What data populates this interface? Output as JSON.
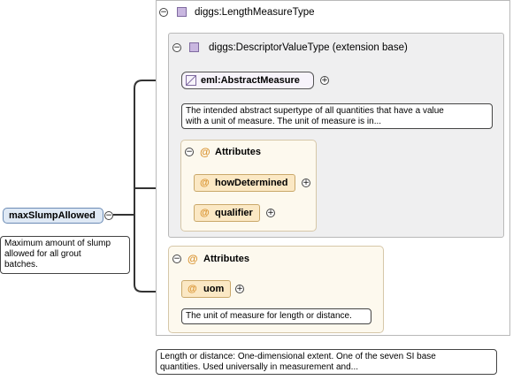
{
  "root": {
    "name": "maxSlumpAllowed",
    "doc": [
      "Maximum amount of slump",
      "allowed for all grout",
      "batches."
    ]
  },
  "type": {
    "name": "diggs:LengthMeasureType",
    "doc": [
      "Length or distance: One-dimensional extent. One of the seven SI base",
      "quantities. Used universally in measurement and..."
    ]
  },
  "extension": {
    "name": "diggs:DescriptorValueType (extension base)"
  },
  "abstract_measure": {
    "name": "eml:AbstractMeasure",
    "doc": [
      "The intended abstract supertype of all quantities that have a value",
      "with a unit of measure. The unit of measure is in..."
    ]
  },
  "inner_attributes": {
    "label": "Attributes",
    "items": [
      "howDetermined",
      "qualifier"
    ]
  },
  "outer_attributes": {
    "label": "Attributes",
    "items": [
      "uom"
    ],
    "uom_doc": "The unit of measure for length or distance."
  },
  "symbols": {
    "at": "@",
    "minus": "−",
    "plus": "+"
  },
  "colors": {
    "type_icon": "#c9b7e0",
    "root_fill": "#dfe9f5",
    "attr_fill": "#fbe8c4",
    "attr_group_fill": "#fdf9ee"
  }
}
